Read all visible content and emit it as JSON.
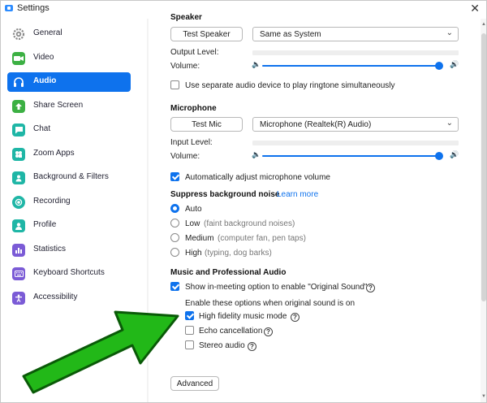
{
  "window": {
    "title": "Settings",
    "close_glyph": "✕"
  },
  "sidebar": {
    "items": [
      {
        "label": "General",
        "icon": "gear-icon",
        "color": "#7c7c7c"
      },
      {
        "label": "Video",
        "icon": "video-camera-icon",
        "color": "#3cb043"
      },
      {
        "label": "Audio",
        "icon": "headphones-icon",
        "color": "#ffffff",
        "active": true
      },
      {
        "label": "Share Screen",
        "icon": "share-screen-icon",
        "color": "#3cb043"
      },
      {
        "label": "Chat",
        "icon": "chat-bubble-icon",
        "color": "#1fb6a6"
      },
      {
        "label": "Zoom Apps",
        "icon": "apps-icon",
        "color": "#1fb6a6"
      },
      {
        "label": "Background & Filters",
        "icon": "person-frame-icon",
        "color": "#1fb6a6"
      },
      {
        "label": "Recording",
        "icon": "record-icon",
        "color": "#1fb6a6"
      },
      {
        "label": "Profile",
        "icon": "profile-icon",
        "color": "#1fb6a6"
      },
      {
        "label": "Statistics",
        "icon": "statistics-icon",
        "color": "#7b5bd6"
      },
      {
        "label": "Keyboard Shortcuts",
        "icon": "keyboard-icon",
        "color": "#7b5bd6"
      },
      {
        "label": "Accessibility",
        "icon": "accessibility-icon",
        "color": "#7b5bd6"
      }
    ]
  },
  "speaker": {
    "title": "Speaker",
    "test_button": "Test Speaker",
    "device": "Same as System",
    "output_level_label": "Output Level:",
    "volume_label": "Volume:",
    "volume_level": 0.97
  },
  "ringtone": {
    "label": "Use separate audio device to play ringtone simultaneously",
    "checked": false
  },
  "microphone": {
    "title": "Microphone",
    "test_button": "Test Mic",
    "device": "Microphone (Realtek(R) Audio)",
    "input_level_label": "Input Level:",
    "volume_label": "Volume:",
    "volume_level": 0.97
  },
  "auto_adjust": {
    "label": "Automatically adjust microphone volume",
    "checked": true
  },
  "noise": {
    "title": "Suppress background noise",
    "learn_more": "Learn more",
    "options": [
      {
        "label": "Auto",
        "hint": "",
        "selected": true
      },
      {
        "label": "Low",
        "hint": "(faint background noises)",
        "selected": false
      },
      {
        "label": "Medium",
        "hint": "(computer fan, pen taps)",
        "selected": false
      },
      {
        "label": "High",
        "hint": "(typing, dog barks)",
        "selected": false
      }
    ]
  },
  "music": {
    "title": "Music and Professional Audio",
    "original_sound": {
      "label": "Show in-meeting option to enable \"Original Sound\"",
      "checked": true
    },
    "sub_label": "Enable these options when original sound is on",
    "options": [
      {
        "label": "High fidelity music mode",
        "checked": true
      },
      {
        "label": "Echo cancellation",
        "checked": false
      },
      {
        "label": "Stereo audio",
        "checked": false
      }
    ]
  },
  "advanced_button": "Advanced",
  "colors": {
    "accent": "#0e72ed",
    "arrow_fill": "#22b818",
    "arrow_stroke": "#0a5a08"
  }
}
